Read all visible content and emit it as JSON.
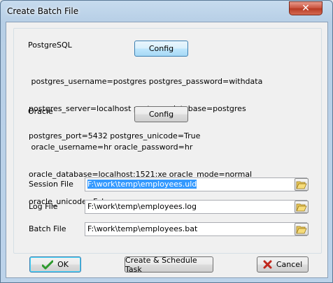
{
  "window": {
    "title": "Create Batch File",
    "close_glyph": "✕"
  },
  "postgres": {
    "heading": "PostgreSQL",
    "config_label": "Config",
    "info_lines": [
      " postgres_username=postgres postgres_password=withdata",
      "postgres_server=localhost postgres_database=postgres",
      "postgres_port=5432 postgres_unicode=True"
    ]
  },
  "oracle": {
    "heading": "Oracle",
    "config_label": "Config",
    "info_lines": [
      " oracle_username=hr oracle_password=hr",
      "oracle_database=localhost:1521:xe oracle_mode=normal",
      "oracle_unicode=False"
    ]
  },
  "files": {
    "session_label": "Session File",
    "session_value": "F:\\work\\temp\\employees.uld",
    "log_label": "Log File",
    "log_value": "F:\\work\\temp\\employees.log",
    "batch_label": "Batch File",
    "batch_value": "F:\\work\\temp\\employees.bat"
  },
  "footer": {
    "ok_label": "OK",
    "schedule_label": "Create & Schedule Task",
    "cancel_label": "Cancel"
  },
  "colors": {
    "selection": "#3399ff",
    "ok_check": "#2e9a2e",
    "cancel_x": "#c0281e"
  },
  "icons": {
    "browse": "folder-open-icon",
    "ok": "checkmark-icon",
    "cancel": "cross-icon"
  }
}
